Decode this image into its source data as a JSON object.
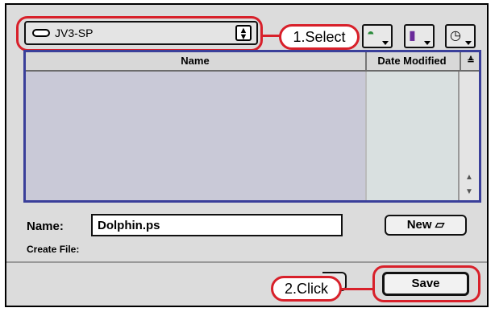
{
  "location": {
    "label": "JV3-SP",
    "icon": "disk-icon",
    "arrows_icon": "updown-arrows-icon"
  },
  "toolbar": {
    "icons": [
      "desktop-icon",
      "documents-icon",
      "clock-icon"
    ]
  },
  "list": {
    "col_name": "Name",
    "col_date": "Date Modified",
    "sort_icon": "sort-icon"
  },
  "file": {
    "name_label": "Name:",
    "value": "Dolphin.ps",
    "new_label": "New",
    "create_label": "Create File:"
  },
  "buttons": {
    "save_label": "Save"
  },
  "annotations": {
    "step1": "1.Select",
    "step2": "2.Click"
  },
  "colors": {
    "callout": "#d8202a",
    "list_bg": "#c9c9d7",
    "list_border": "#3a3f9a"
  }
}
